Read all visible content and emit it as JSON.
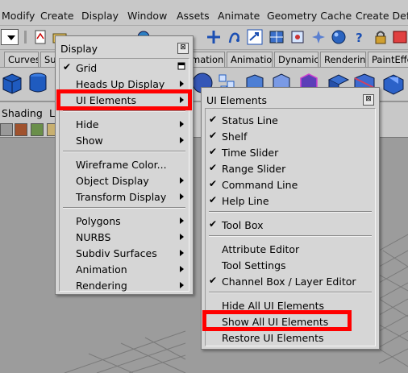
{
  "menubar": {
    "items": [
      "Modify",
      "Create",
      "Display",
      "Window",
      "Assets",
      "Animate",
      "Geometry Cache",
      "Create Defo"
    ]
  },
  "shelf_tabs": [
    "Curves",
    "Su",
    "mation",
    "Animation",
    "Dynamics",
    "Rendering",
    "PaintEffe"
  ],
  "panel_menus": [
    "Shading",
    "Li"
  ],
  "display_menu": {
    "title": "Display",
    "items": [
      {
        "label": "Grid",
        "checked": true,
        "option_box": true
      },
      {
        "label": "Heads Up Display",
        "submenu": true
      },
      {
        "label": "UI Elements",
        "submenu": true
      },
      {
        "label": "Hide",
        "submenu": true
      },
      {
        "label": "Show",
        "submenu": true
      },
      {
        "label": "Wireframe Color..."
      },
      {
        "label": "Object Display",
        "submenu": true
      },
      {
        "label": "Transform Display",
        "submenu": true
      },
      {
        "label": "Polygons",
        "submenu": true
      },
      {
        "label": "NURBS",
        "submenu": true
      },
      {
        "label": "Subdiv Surfaces",
        "submenu": true
      },
      {
        "label": "Animation",
        "submenu": true
      },
      {
        "label": "Rendering",
        "submenu": true
      }
    ]
  },
  "ui_elements_menu": {
    "title": "UI Elements",
    "items": [
      {
        "label": "Status Line",
        "checked": true
      },
      {
        "label": "Shelf",
        "checked": true
      },
      {
        "label": "Time Slider",
        "checked": true
      },
      {
        "label": "Range Slider",
        "checked": true
      },
      {
        "label": "Command Line",
        "checked": true
      },
      {
        "label": "Help Line",
        "checked": true
      },
      {
        "label": "Tool Box",
        "checked": true
      },
      {
        "label": "Attribute Editor"
      },
      {
        "label": "Tool Settings"
      },
      {
        "label": "Channel Box / Layer Editor",
        "checked": true
      },
      {
        "label": "Hide All UI Elements"
      },
      {
        "label": "Show All UI Elements"
      },
      {
        "label": "Restore UI Elements"
      }
    ]
  },
  "colors": {
    "menu_bg": "#d6d6d6",
    "highlight": "#ff0000",
    "viewport_bg": "#9c9c9c"
  }
}
